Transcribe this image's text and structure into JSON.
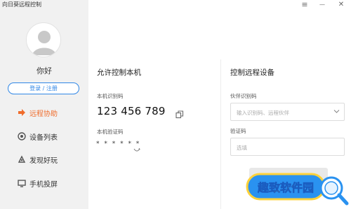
{
  "app": {
    "title": "向日葵远程控制"
  },
  "window_controls": {
    "menu": "≡",
    "minimize": "—",
    "close": "✕"
  },
  "sidebar": {
    "greeting": "你好",
    "login_label": "登录 / 注册",
    "items": [
      {
        "label": "远程协助",
        "icon": "remote-assist-icon",
        "active": true
      },
      {
        "label": "设备列表",
        "icon": "device-list-icon",
        "active": false
      },
      {
        "label": "发现好玩",
        "icon": "discover-icon",
        "active": false
      },
      {
        "label": "手机投屏",
        "icon": "screen-cast-icon",
        "active": false
      }
    ]
  },
  "local": {
    "title": "允许控制本机",
    "id_label": "本机识别码",
    "id_value": "123 456 789",
    "code_label": "本机验证码",
    "code_value": "* * * * * *"
  },
  "remote": {
    "title": "控制远程设备",
    "partner_label": "伙伴识别码",
    "partner_placeholder": "输入识别码、远程伙伴",
    "code_label": "验证码",
    "code_placeholder": "选填"
  },
  "watermark": {
    "text": "趣致软件园"
  },
  "colors": {
    "accent": "#2f86e6",
    "active": "#f06c2b",
    "sidebar_bg": "#f1f1f1"
  }
}
